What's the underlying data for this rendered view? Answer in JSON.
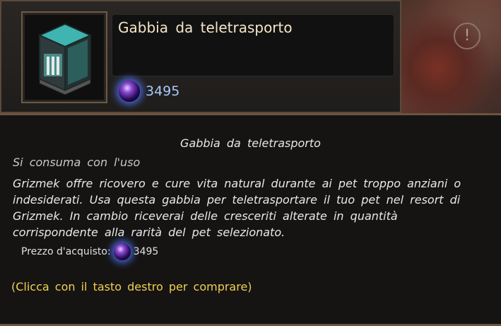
{
  "item": {
    "name": "Gabbia da teletrasporto",
    "icon": "teleport-cage-icon",
    "price": "3495",
    "currency_icon": "purple-orb-icon"
  },
  "tooltip": {
    "title": "Gabbia da teletrasporto",
    "consume_note": "Si consuma con l'uso",
    "description": "Grizmek offre ricovero e cure vita natural durante ai pet troppo anziani o indesiderati. Usa questa gabbia per teletrasportare il tuo pet nel resort di Grizmek. In cambio riceverai delle cresceriti alterate in quantità corrispondente alla rarità del pet selezionato.",
    "price_label": "Prezzo d'acquisto:",
    "price_value": "3495",
    "hint": "(Clicca con il tasto destro per comprare)"
  },
  "colors": {
    "title_text": "#f5e6c8",
    "price_text": "#a8c8ff",
    "hint_text": "#f0d050",
    "frame": "#6b5440"
  }
}
